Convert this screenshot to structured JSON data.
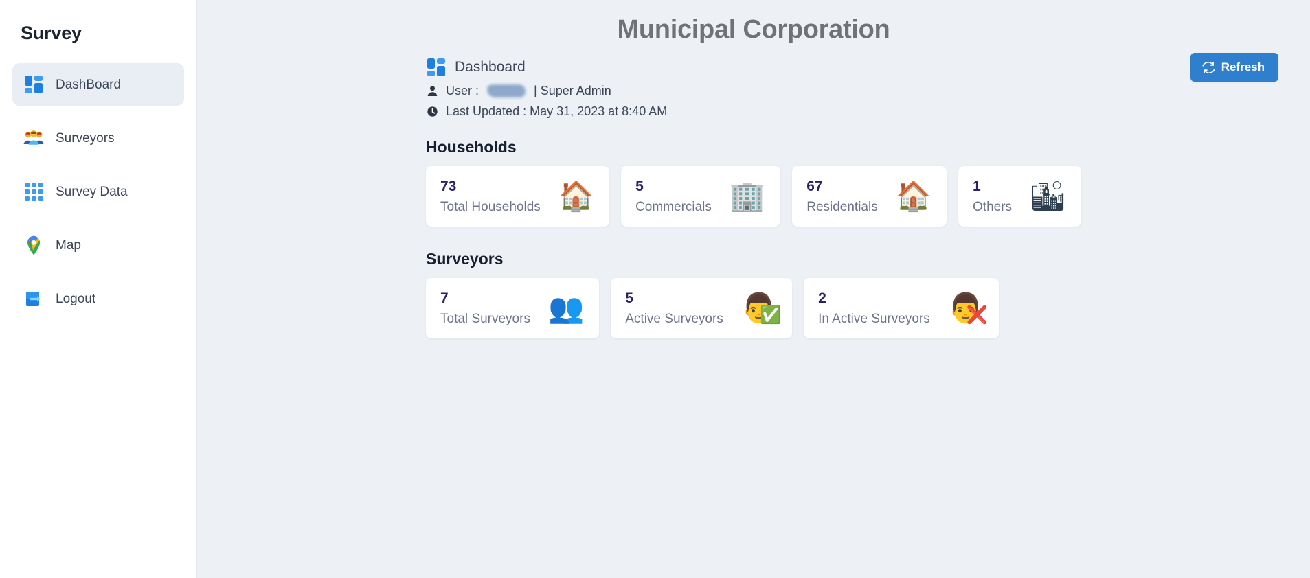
{
  "sidebar": {
    "brand": "Survey",
    "items": [
      {
        "label": "DashBoard",
        "icon": "dashboard-tiles-icon",
        "active": true
      },
      {
        "label": "Surveyors",
        "icon": "people-group-icon",
        "active": false
      },
      {
        "label": "Survey Data",
        "icon": "grid-3x3-icon",
        "active": false
      },
      {
        "label": "Map",
        "icon": "map-pin-icon",
        "active": false
      },
      {
        "label": "Logout",
        "icon": "logout-arrow-icon",
        "active": false
      }
    ]
  },
  "header": {
    "title": "Municipal Corporation",
    "refresh_label": "Refresh",
    "refresh_icon": "sync-refresh-icon",
    "breadcrumb": "Dashboard",
    "breadcrumb_icon": "dashboard-tiles-icon",
    "user_icon": "person-icon",
    "user_prefix": "User :",
    "user_name_redacted": "",
    "user_role": "| Super Admin",
    "clock_icon": "clock-icon",
    "last_updated": "Last Updated : May 31, 2023 at 8:40 AM"
  },
  "sections": [
    {
      "title": "Households",
      "cards": [
        {
          "value": "73",
          "label": "Total Households",
          "icon": "house-icon",
          "emoji": "🏠",
          "badge": ""
        },
        {
          "value": "5",
          "label": "Commercials",
          "icon": "office-building-icon",
          "emoji": "🏢",
          "badge": ""
        },
        {
          "value": "67",
          "label": "Residentials",
          "icon": "house-icon",
          "emoji": "🏠",
          "badge": ""
        },
        {
          "value": "1",
          "label": "Others",
          "icon": "cityscape-icon",
          "emoji": "🏙",
          "badge": ""
        }
      ]
    },
    {
      "title": "Surveyors",
      "cards": [
        {
          "value": "7",
          "label": "Total Surveyors",
          "icon": "people-group-icon",
          "emoji": "👥",
          "badge": ""
        },
        {
          "value": "5",
          "label": "Active Surveyors",
          "icon": "person-check-icon",
          "emoji": "👨",
          "badge": "✅"
        },
        {
          "value": "2",
          "label": "In Active Surveyors",
          "icon": "person-remove-icon",
          "emoji": "👨",
          "badge": "❌"
        }
      ]
    }
  ],
  "colors": {
    "accent": "#2e80ce",
    "page_bg": "#edf1f5",
    "card_bg": "#ffffff",
    "stat_value": "#2b1f6b",
    "stat_label": "#6b7488",
    "title": "#6f7276",
    "active_nav_bg": "#e9eef4"
  }
}
